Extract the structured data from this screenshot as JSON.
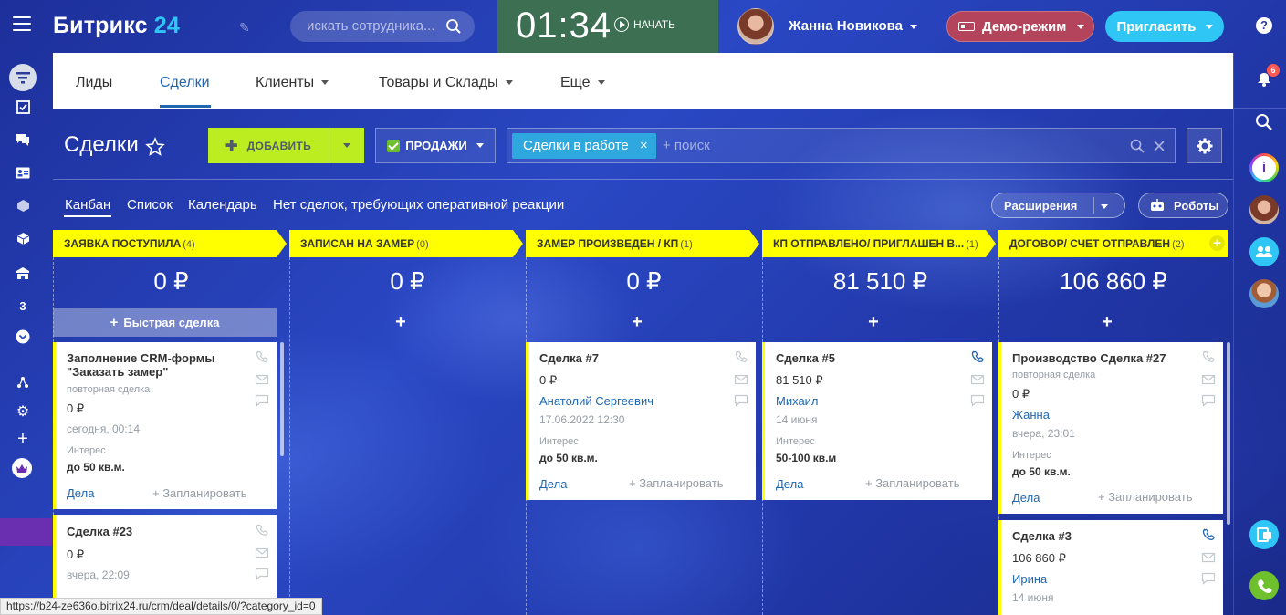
{
  "app": {
    "logo_name": "Битрикс",
    "logo_num": "24"
  },
  "top": {
    "search_placeholder": "искать сотрудника...",
    "clock": "01:34",
    "start": "НАЧАТЬ",
    "user_name": "Жанна Новикова",
    "demo": "Демо-режим",
    "invite": "Пригласить",
    "help": "?"
  },
  "left_sidebar": {
    "counter": "3"
  },
  "right_sidebar": {
    "notif_count": "6"
  },
  "nav": {
    "items": [
      "Лиды",
      "Сделки",
      "Клиенты",
      "Товары и Склады",
      "Еще"
    ]
  },
  "header": {
    "title": "Сделки",
    "add": "ДОБАВИТЬ",
    "pipeline": "ПРОДАЖИ",
    "filter_chip": "Сделки в работе",
    "filter_placeholder": "+ поиск"
  },
  "views": {
    "items": [
      "Канбан",
      "Список",
      "Календарь",
      "Нет сделок, требующих оперативной реакции"
    ],
    "extensions": "Расширения",
    "robots": "Роботы"
  },
  "columns": [
    {
      "title": "ЗАЯВКА ПОСТУПИЛА",
      "count": "(4)",
      "sum": "0 ₽"
    },
    {
      "title": "ЗАПИСАН НА ЗАМЕР",
      "count": "(0)",
      "sum": "0 ₽"
    },
    {
      "title": "ЗАМЕР ПРОИЗВЕДЕН / КП",
      "count": "(1)",
      "sum": "0 ₽"
    },
    {
      "title": "КП ОТПРАВЛЕНО/ ПРИГЛАШЕН В...",
      "count": "(1)",
      "sum": "81 510 ₽"
    },
    {
      "title": "ДОГОВОР/ СЧЕТ ОТПРАВЛЕН",
      "count": "(2)",
      "sum": "106 860 ₽"
    }
  ],
  "quick_deal": "Быстрая сделка",
  "cards": {
    "c1": {
      "title1": "Заполнение CRM-формы",
      "title2": "\"Заказать замер\"",
      "sub": "повторная сделка",
      "price": "0 ₽",
      "date": "сегодня, 00:14",
      "field_label": "Интерес",
      "field_value": "до 50 кв.м.",
      "tasks": "Дела",
      "plan": "+ Запланировать"
    },
    "c2": {
      "title": "Сделка #23",
      "price": "0 ₽",
      "date": "вчера, 22:09"
    },
    "c3": {
      "title": "Сделка #7",
      "price": "0 ₽",
      "contact": "Анатолий Сергеевич",
      "date": "17.06.2022 12:30",
      "field_label": "Интерес",
      "field_value": "до 50 кв.м.",
      "tasks": "Дела",
      "plan": "+ Запланировать"
    },
    "c4": {
      "title": "Сделка #5",
      "price": "81 510 ₽",
      "contact": "Михаил",
      "date": "14 июня",
      "field_label": "Интерес",
      "field_value": "50-100 кв.м",
      "tasks": "Дела",
      "plan": "+ Запланировать"
    },
    "c5": {
      "title": "Производство Сделка #27",
      "sub": "повторная сделка",
      "price": "0 ₽",
      "contact": "Жанна",
      "date": "вчера, 23:01",
      "field_label": "Интерес",
      "field_value": "до 50 кв.м.",
      "tasks": "Дела",
      "plan": "+ Запланировать"
    },
    "c6": {
      "title": "Сделка #3",
      "price": "106 860 ₽",
      "contact": "Ирина",
      "date": "14 июня"
    }
  },
  "statusbar": "https://b24-ze636o.bitrix24.ru/crm/deal/details/0/?category_id=0",
  "colors": {
    "accent": "#2fc6f6",
    "add": "#bbed21",
    "stage": "#ffff00",
    "demo": "#b3445b",
    "link": "#2067b0"
  }
}
